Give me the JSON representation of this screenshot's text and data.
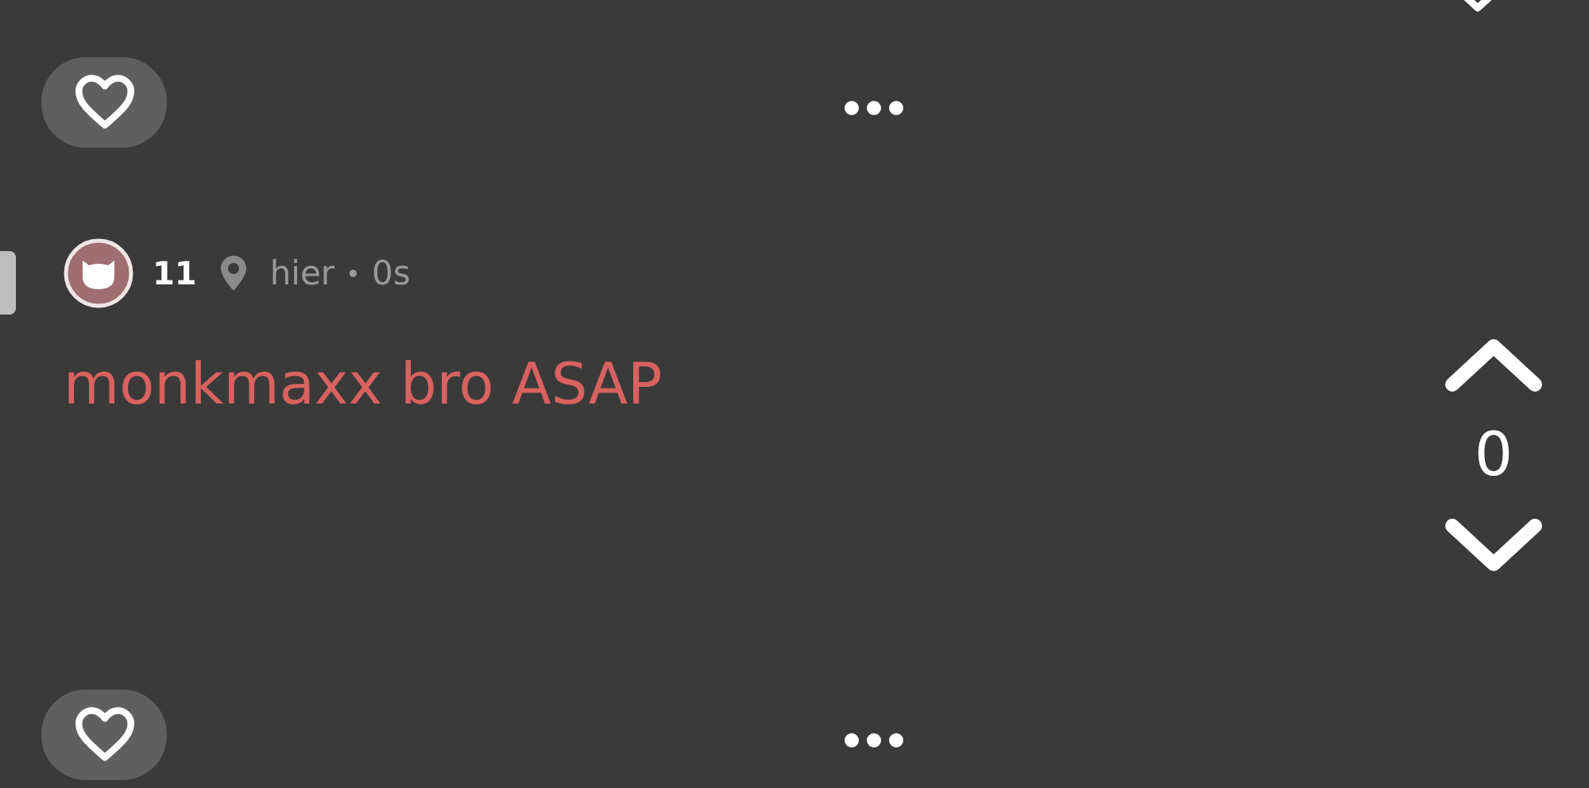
{
  "previous_post": {
    "liked": false
  },
  "post": {
    "score": "11",
    "location": "hier",
    "separator": "•",
    "time": "0s",
    "text": "monkmaxx bro ASAP",
    "votes": "0",
    "liked": false
  }
}
